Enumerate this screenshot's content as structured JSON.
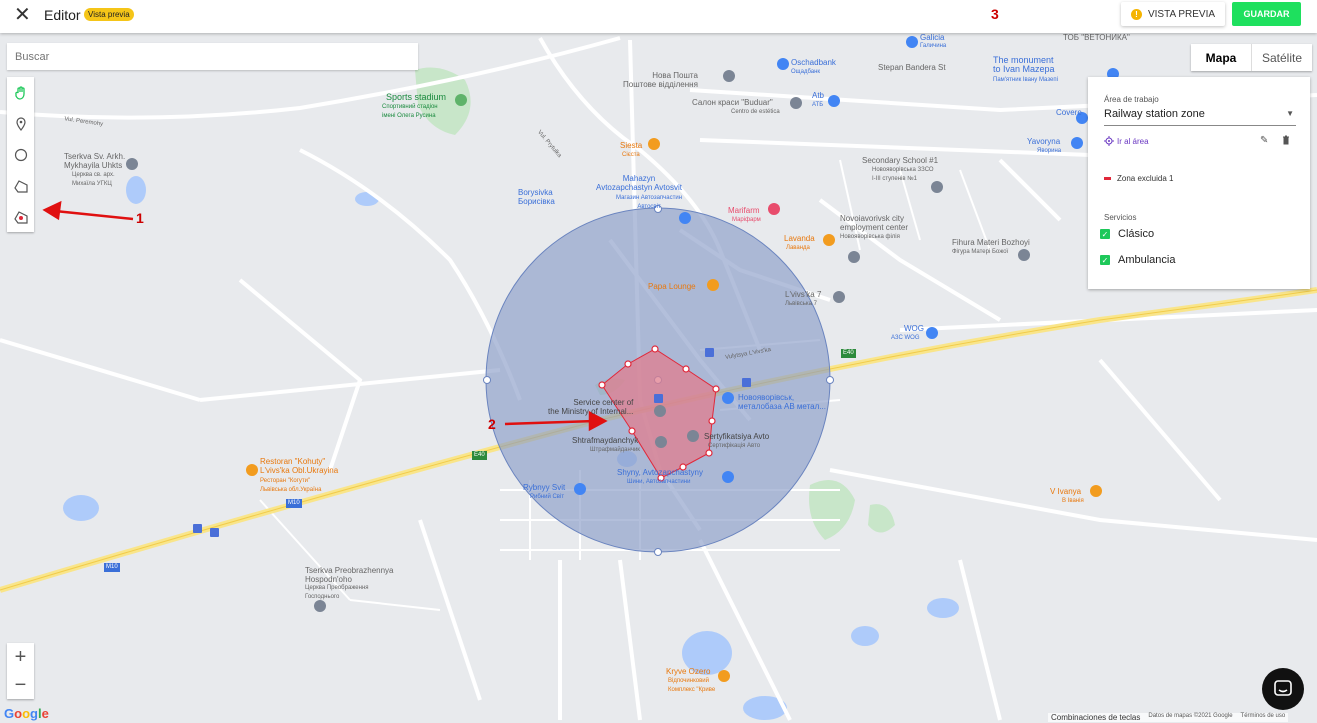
{
  "header": {
    "close_label": "✕",
    "title": "Editor",
    "badge": "Vista previa",
    "preview_button": "VISTA PREVIA",
    "preview_icon": "!",
    "save_button": "GUARDAR"
  },
  "annotations": {
    "one": "1",
    "two": "2",
    "three": "3"
  },
  "search": {
    "placeholder": "Buscar"
  },
  "tools": [
    "hand-tool",
    "marker-tool",
    "circle-tool",
    "polygon-tool",
    "exclusion-zone-tool"
  ],
  "map_type": {
    "map": "Mapa",
    "satellite": "Satélite"
  },
  "panel": {
    "area_label": "Área de trabajo",
    "area_value": "Railway station zone",
    "caret": "▼",
    "goto_label": "Ir al área",
    "edit_icon": "✎",
    "delete_icon": "🗑",
    "zone_label": "Zona excluida 1",
    "services_label": "Servicios",
    "services": [
      "Clásico",
      "Ambulancia"
    ],
    "check": "✓"
  },
  "zoom": {
    "in": "+",
    "out": "−"
  },
  "google_logo": "Google",
  "footer": {
    "shortcuts": "Combinaciones de teclas",
    "data": "Datos de mapas ©2021 Google",
    "terms": "Términos de uso"
  },
  "map_labels": {
    "sports": "Sports stadium",
    "sports_sub": "Спортивний стадіон\nімені Олега Русина",
    "tserkva": "Tserkva Sv. Arkh.\nMykhayila Uhkts",
    "tserkva_sub": "Церква св. арх.\nМихаїла УГКЦ",
    "nova": "Нова Пошта\nПоштове відділення",
    "salon": "Салон краси \"Buduar\"",
    "salon_sub": "Centro de estética",
    "atb": "Atb",
    "atb_sub": "АТБ",
    "oschad": "Oschadbank",
    "oschad_sub": "Ощадбанк",
    "siesta": "Siesta",
    "siesta_sub": "Сієста",
    "mahazyn": "Mahazyn\nAvtozapchastyn Avtosvit",
    "mahazyn_sub": "Магазин Автозапчастин\nАвтосвіт",
    "borysivka": "Borysivka\nБорисівка",
    "marifarm": "Marifarm",
    "marifarm_sub": "Марiфарм",
    "lavanda": "Lavanda",
    "lavanda_sub": "Лаванда",
    "school": "Secondary School #1",
    "school_sub": "Новояворівська ЗЗСО\nІ-ІІІ ступенів №1",
    "employment": "Novoiavorivsk city\nemployment center",
    "employment_sub": "Новояворівська філія",
    "fihura": "Fihura Materi Bozhoyi",
    "fihura_sub": "Фігура Матері Божої",
    "papa": "Papa Lounge",
    "lvivska7": "L'vivs'ka 7",
    "lvivska7_sub": "Львівська 7",
    "wog": "WOG",
    "wog_sub": "АЗС WOG",
    "service": "Service center of\nthe Ministry of Internal...",
    "service_sub": "Сервісний центр МВС",
    "novo": "Новояворівськ,\nметалобаза АВ метал...",
    "shtraf": "Shtrafmaydanchyk",
    "shtraf_sub": "Штрафмайданчик",
    "sertyf": "Sertyfikatsiya Avto",
    "sertyf_sub": "Сертифікація Авто",
    "shyny": "Shyny, Avtozapchastyny",
    "shyny_sub": "Шини, Автозапчастини",
    "rybnyy": "Rybnyy Svit",
    "rybnyy_sub": "Рибний Світ",
    "restoran": "Restoran \"Kohuty\"\nL'vivs'ka Obl.Ukrayina",
    "restoran_sub": "Ресторан \"Когути\"\nЛьвівська обл.Україна",
    "vivanya": "V Ivanya",
    "vivanya_sub": "В Іванія",
    "preobr": "Tserkva Preobrazhennya\nHospodn'oho",
    "preobr_sub": "Церква Преображення\nГосподнього",
    "kryve": "Kryve Ozero",
    "kryve_sub": "Відпочинковий\nКомплекс \"Криве",
    "galicia": "Galicia",
    "galicia_sub": "Галичина",
    "monument": "The monument\nto Ivan Mazepa",
    "monument_sub": "Пам'ятник Івану Мазепі",
    "yavoryna": "Yavoryna",
    "yavoryna_sub": "Яворина",
    "bandera": "Stepan Bandera St",
    "tob": "ТОБ \"ВЕТОНИКА\"",
    "coverco": "Covere",
    "road_e40": "E40",
    "road_m10": "M10",
    "vul_lvivska": "Vulytsya L'vivs'ka",
    "vul_peremohy": "Vul. Peremohy",
    "vul_prytulka": "Vul. Prytulka"
  }
}
